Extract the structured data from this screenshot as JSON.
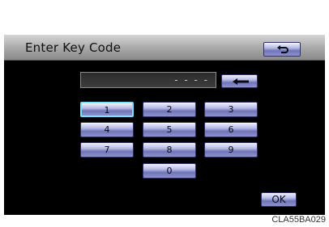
{
  "header": {
    "title": "Enter Key Code",
    "back_icon": "back-arrow-icon"
  },
  "code_field": {
    "value": "- - - -"
  },
  "backspace": {
    "icon": "backspace-arrow-icon"
  },
  "keys": [
    "1",
    "2",
    "3",
    "4",
    "5",
    "6",
    "7",
    "8",
    "9",
    "0"
  ],
  "ok_label": "OK",
  "caption": "CLA55BA029",
  "colors": {
    "button": "#8e92cf",
    "selected_border": "#7ee0ff",
    "screen": "#000000"
  }
}
